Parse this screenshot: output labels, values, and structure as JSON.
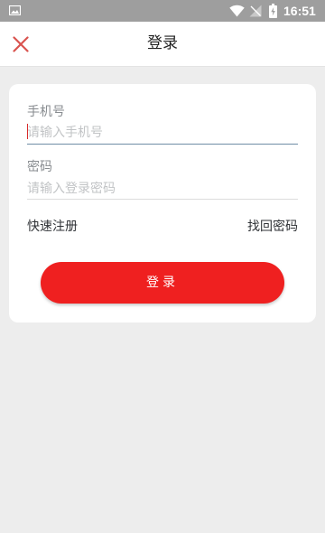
{
  "status_bar": {
    "time": "16:51",
    "icons": [
      "image-icon",
      "wifi-icon",
      "signal-off-icon",
      "battery-charging-icon"
    ]
  },
  "header": {
    "title": "登录",
    "close_icon": "close-icon"
  },
  "form": {
    "phone_label": "手机号",
    "phone_value": "",
    "phone_placeholder": "请输入手机号",
    "password_label": "密码",
    "password_value": "",
    "password_placeholder": "请输入登录密码",
    "register_link": "快速注册",
    "forgot_link": "找回密码",
    "login_button": "登录"
  },
  "colors": {
    "accent": "#ef2020",
    "close_icon": "#d9534f",
    "background": "#ededed"
  }
}
